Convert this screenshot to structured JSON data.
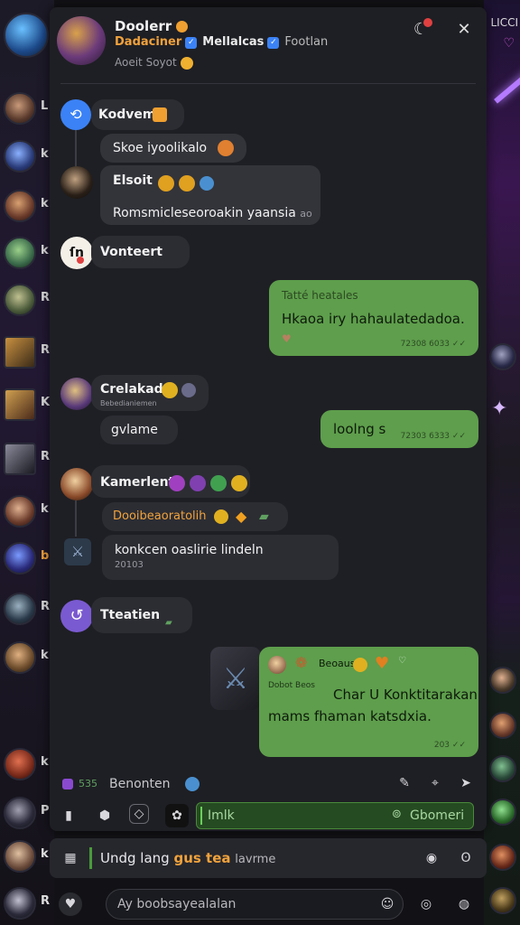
{
  "header": {
    "name": "Doolerr",
    "subtitle_orange": "Dadaciner",
    "subtitle_badge1": "Mellalcas",
    "subtitle_badge2": "Footlan",
    "status": "Aoeit Soyot",
    "close_icon": "close-icon",
    "moon_icon": "moon-icon"
  },
  "right_edge": {
    "label": "LICCI"
  },
  "messages": [
    {
      "author": "Kodvem",
      "text": "Skoe iyoolikalo"
    },
    {
      "author": "Elsoit",
      "text": "Romsmicleseoroakin yaansia",
      "time": "ao"
    },
    {
      "author": "Vonteert"
    },
    {
      "header": "Tatté heatales",
      "text": "Hkaoa iry hahaulatedadoa.",
      "time": "72308 6033"
    },
    {
      "author": "Crelakadr",
      "sub": "Bebedianiemen",
      "text": "gvlame"
    },
    {
      "text": "loolng s",
      "time": "72303 6333"
    },
    {
      "author": "Kamerlent",
      "highlight": "Dooibeaoratolih",
      "text": "konkcen oaslirie lindeln",
      "sub": "20103"
    },
    {
      "author": "Tteatien"
    },
    {
      "badge": "Beoaus",
      "sender": "Dobot Beos",
      "text": "Char U Konktitarakan",
      "text2": "mams fhaman katsdxia.",
      "time": "203"
    }
  ],
  "footer": {
    "count": "535",
    "name": "Benonten",
    "input_label": "Imlk",
    "input_right": "Gbomeri"
  },
  "compose": {
    "text": "Undg lang",
    "highlight": "gus tea",
    "tail": "lavrme"
  },
  "bottom": {
    "placeholder": "Ay boobsayealalan"
  },
  "colors": {
    "accent_green": "#5e9e4c",
    "accent_orange": "#f1a23c",
    "panel": "#1e1f24"
  }
}
